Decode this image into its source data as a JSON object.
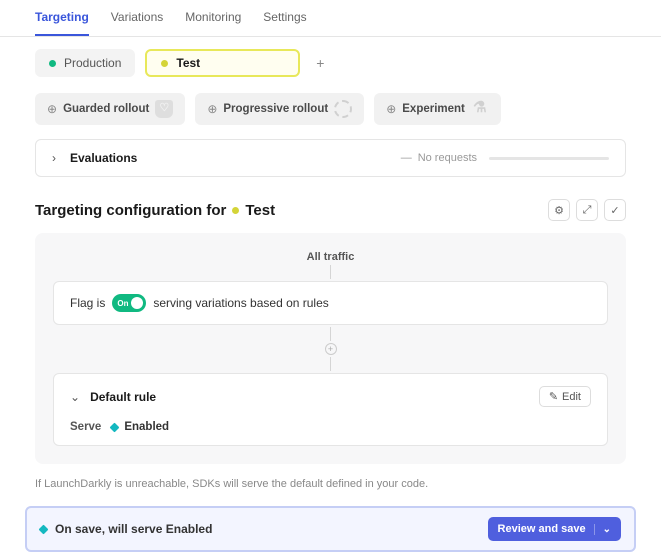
{
  "tabs": {
    "targeting": "Targeting",
    "variations": "Variations",
    "monitoring": "Monitoring",
    "settings": "Settings"
  },
  "environments": {
    "production": "Production",
    "test": "Test",
    "add_tooltip": "+"
  },
  "rollout": {
    "guarded": "Guarded rollout",
    "progressive": "Progressive rollout",
    "experiment": "Experiment"
  },
  "evaluations": {
    "title": "Evaluations",
    "status": "No requests"
  },
  "config": {
    "title_prefix": "Targeting configuration for",
    "env_label": "Test",
    "all_traffic": "All traffic",
    "flag_prefix": "Flag is",
    "toggle_label": "On",
    "flag_suffix": "serving variations based on rules",
    "default_rule": {
      "title": "Default rule",
      "edit": "Edit",
      "serve_label": "Serve",
      "serve_value": "Enabled"
    },
    "unreachable": "If LaunchDarkly is unreachable, SDKs will serve the default defined in your code."
  },
  "save_bar": {
    "message": "On save, will serve Enabled",
    "button": "Review and save"
  }
}
